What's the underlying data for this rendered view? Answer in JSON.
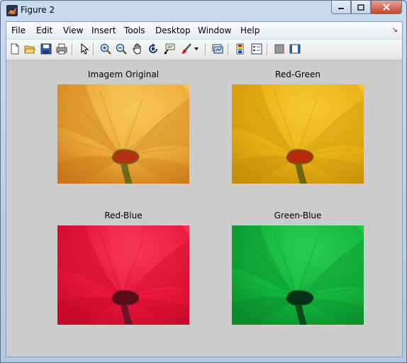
{
  "window": {
    "title": "Figure 2",
    "icon": "matlab-icon"
  },
  "menu": [
    "File",
    "Edit",
    "View",
    "Insert",
    "Tools",
    "Desktop",
    "Window",
    "Help"
  ],
  "toolbar": [
    "new-figure-icon",
    "open-file-icon",
    "save-icon",
    "print-icon",
    "edit-plot-icon",
    "zoom-in-icon",
    "zoom-out-icon",
    "pan-icon",
    "rotate-3d-icon",
    "data-cursor-icon",
    "brush-icon",
    "link-plot-icon",
    "colorbar-icon",
    "legend-icon",
    "hide-plot-tools-icon",
    "show-plot-tools-icon"
  ],
  "subplots": [
    {
      "title": "Imagem Original",
      "palette": {
        "dark": "#c8761a",
        "mid": "#ecaa3a",
        "light": "#f7c65a",
        "stem": "#6e6a1c",
        "center": "#b33310"
      }
    },
    {
      "title": "Red-Green",
      "palette": {
        "dark": "#c88d0a",
        "mid": "#e8b013",
        "light": "#f4c832",
        "stem": "#6c6614",
        "center": "#b62c0a"
      }
    },
    {
      "title": "Red-Blue",
      "palette": {
        "dark": "#c3082a",
        "mid": "#e9163a",
        "light": "#f5385a",
        "stem": "#6c1428",
        "center": "#5a0c1a"
      }
    },
    {
      "title": "Green-Blue",
      "palette": {
        "dark": "#0a8a2a",
        "mid": "#12b53c",
        "light": "#28cc52",
        "stem": "#0c4a1c",
        "center": "#06301a"
      }
    }
  ]
}
